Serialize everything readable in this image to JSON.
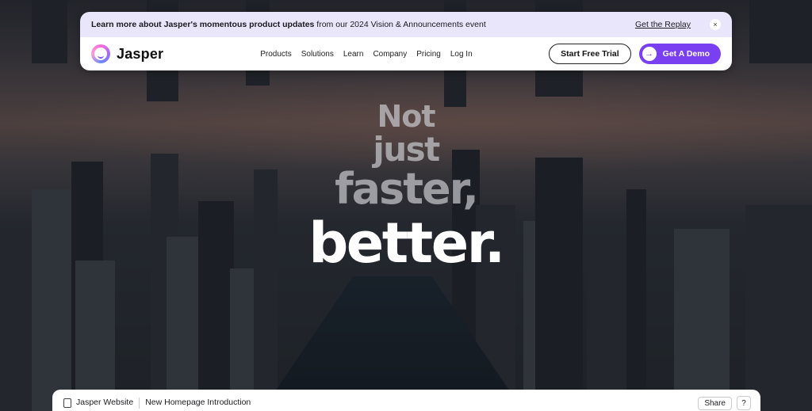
{
  "announcement": {
    "bold_text": "Learn more about Jasper's momentous product updates",
    "rest_text": " from our 2024 Vision & Announcements event",
    "replay_link": "Get the Replay",
    "close_glyph": "×"
  },
  "nav": {
    "brand": "Jasper",
    "items": [
      {
        "label": "Products"
      },
      {
        "label": "Solutions"
      },
      {
        "label": "Learn"
      },
      {
        "label": "Company"
      },
      {
        "label": "Pricing"
      },
      {
        "label": "Log In"
      }
    ],
    "trial_button": "Start Free Trial",
    "demo_button": "Get A Demo",
    "demo_arrow": "→"
  },
  "hero": {
    "line1": "Not",
    "line2": "just",
    "line3": "faster,",
    "line4": "better."
  },
  "bottom_bar": {
    "site": "Jasper Website",
    "page": "New Homepage Introduction",
    "share": "Share",
    "help": "?"
  },
  "colors": {
    "accent": "#7b3ff2",
    "announcement_bg": "#e9e6fb"
  }
}
